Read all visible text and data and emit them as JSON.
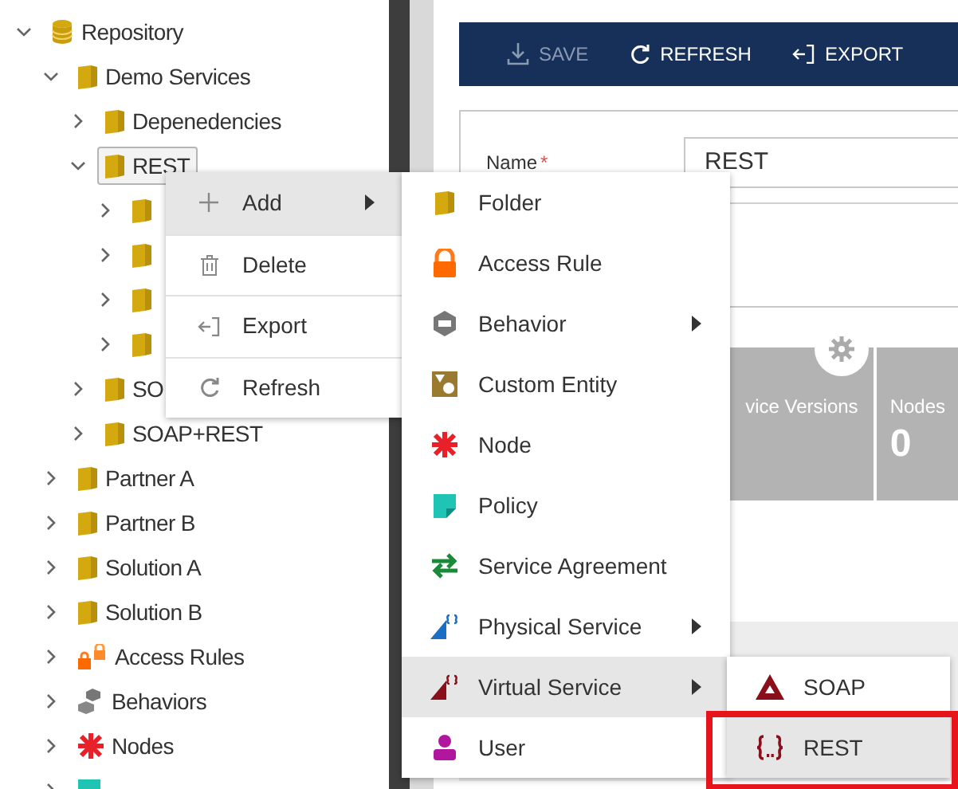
{
  "tree": [
    {
      "label": "Repository",
      "kind": "database",
      "expanded": true,
      "selected": false,
      "children": [
        {
          "label": "Demo Services",
          "kind": "folder",
          "expanded": true,
          "selected": false,
          "children": [
            {
              "label": "Depenedencies",
              "kind": "folder",
              "expanded": false,
              "selected": false
            },
            {
              "label": "REST",
              "kind": "folder",
              "expanded": true,
              "selected": true,
              "children": [
                {
                  "kind": "folder",
                  "expanded": false,
                  "selected": false
                },
                {
                  "kind": "folder",
                  "expanded": false,
                  "selected": false
                },
                {
                  "kind": "folder",
                  "expanded": false,
                  "selected": false
                },
                {
                  "kind": "folder",
                  "expanded": false,
                  "selected": false
                }
              ]
            },
            {
              "label": "SO",
              "kind": "folder",
              "expanded": false,
              "selected": false
            },
            {
              "label": "SOAP+REST",
              "kind": "folder",
              "expanded": false,
              "selected": false
            }
          ]
        },
        {
          "label": "Partner A",
          "kind": "folder",
          "expanded": false,
          "selected": false
        },
        {
          "label": "Partner B",
          "kind": "folder",
          "expanded": false,
          "selected": false
        },
        {
          "label": "Solution A",
          "kind": "folder",
          "expanded": false,
          "selected": false
        },
        {
          "label": "Solution B",
          "kind": "folder",
          "expanded": false,
          "selected": false
        },
        {
          "label": "Access Rules",
          "kind": "locks",
          "expanded": false,
          "selected": false
        },
        {
          "label": "Behaviors",
          "kind": "hexagons",
          "expanded": false,
          "selected": false
        },
        {
          "label": "Nodes",
          "kind": "node",
          "expanded": false,
          "selected": false
        },
        {
          "kind": "policy",
          "expanded": false,
          "selected": false
        }
      ]
    }
  ],
  "toolbar": [
    {
      "label": "SAVE",
      "kind": "save",
      "disabled": true
    },
    {
      "label": "REFRESH",
      "kind": "refresh",
      "disabled": false
    },
    {
      "label": "EXPORT",
      "kind": "export",
      "disabled": false
    }
  ],
  "form": {
    "name_label": "Name",
    "required_mark": "*",
    "name_value": "REST"
  },
  "tiles": [
    {
      "label": "vice Versions"
    },
    {
      "label": "Nodes",
      "value": "0"
    }
  ],
  "context_menu": [
    {
      "label": "Add",
      "kind": "add",
      "selected": true,
      "has_submenu": true
    },
    {
      "label": "Delete",
      "kind": "delete",
      "selected": false,
      "has_submenu": false
    },
    {
      "label": "Export",
      "kind": "export",
      "selected": false,
      "has_submenu": false
    },
    {
      "label": "Refresh",
      "kind": "refresh",
      "selected": false,
      "has_submenu": false
    }
  ],
  "add_menu": [
    {
      "label": "Folder",
      "kind": "folder",
      "selected": false,
      "has_submenu": false
    },
    {
      "label": "Access Rule",
      "kind": "lock",
      "selected": false,
      "has_submenu": false
    },
    {
      "label": "Behavior",
      "kind": "behavior",
      "selected": false,
      "has_submenu": true
    },
    {
      "label": "Custom Entity",
      "kind": "entity",
      "selected": false,
      "has_submenu": false
    },
    {
      "label": "Node",
      "kind": "node",
      "selected": false,
      "has_submenu": false
    },
    {
      "label": "Policy",
      "kind": "policy",
      "selected": false,
      "has_submenu": false
    },
    {
      "label": "Service Agreement",
      "kind": "agreement",
      "selected": false,
      "has_submenu": false
    },
    {
      "label": "Physical Service",
      "kind": "physical",
      "selected": false,
      "has_submenu": true
    },
    {
      "label": "Virtual Service",
      "kind": "virtual",
      "selected": true,
      "has_submenu": true
    },
    {
      "label": "User",
      "kind": "user",
      "selected": false,
      "has_submenu": false
    }
  ],
  "virtual_menu": [
    {
      "label": "SOAP",
      "kind": "soap",
      "selected": false,
      "highlighted_box": false
    },
    {
      "label": "REST",
      "kind": "rest",
      "selected": true,
      "highlighted_box": true
    }
  ]
}
